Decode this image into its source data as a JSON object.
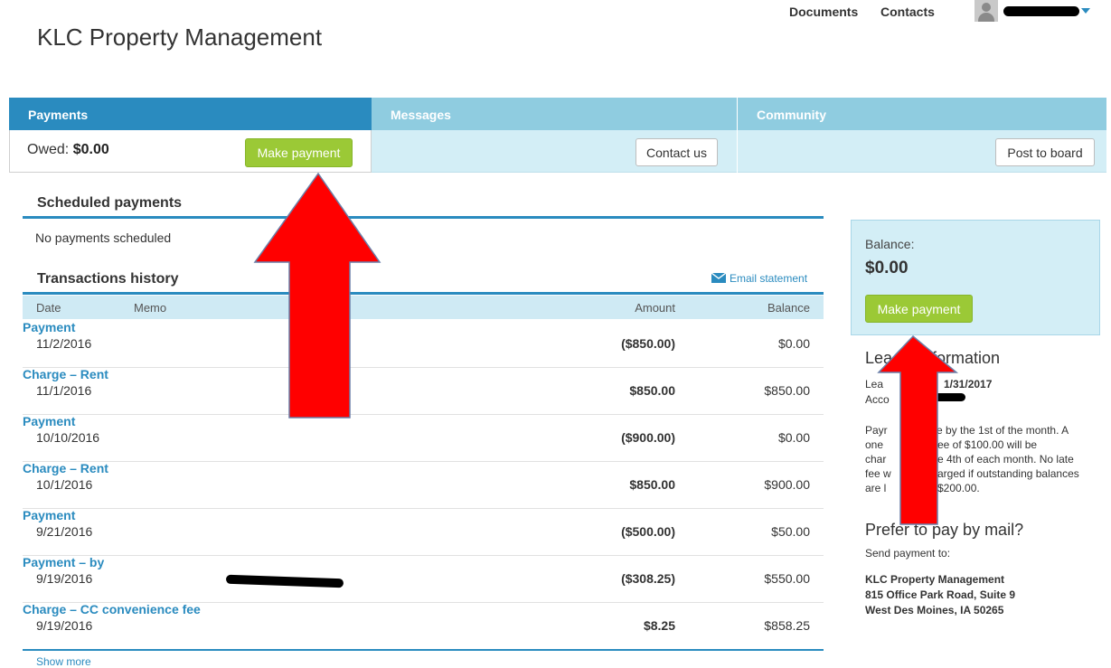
{
  "header": {
    "brand": "KLC Property Management",
    "nav": [
      "Documents",
      "Contacts"
    ]
  },
  "tabs": [
    {
      "label": "Payments",
      "owed_label": "Owed:",
      "owed_value": "$0.00",
      "button": "Make payment"
    },
    {
      "label": "Messages",
      "button": "Contact us"
    },
    {
      "label": "Community",
      "button": "Post to board"
    }
  ],
  "scheduled": {
    "title": "Scheduled payments",
    "empty_text": "No payments scheduled"
  },
  "history": {
    "title": "Transactions history",
    "email_link": "Email statement",
    "columns": [
      "Date",
      "Memo",
      "Amount",
      "Balance"
    ],
    "rows": [
      {
        "date": "11/2/2016",
        "memo": "Payment",
        "amount": "($850.00)",
        "balance": "$0.00"
      },
      {
        "date": "11/1/2016",
        "memo": "Charge – Rent",
        "amount": "$850.00",
        "balance": "$850.00"
      },
      {
        "date": "10/10/2016",
        "memo": "Payment",
        "amount": "($900.00)",
        "balance": "$0.00"
      },
      {
        "date": "10/1/2016",
        "memo": "Charge – Rent",
        "amount": "$850.00",
        "balance": "$900.00"
      },
      {
        "date": "9/21/2016",
        "memo": "Payment",
        "amount": "($500.00)",
        "balance": "$50.00"
      },
      {
        "date": "9/19/2016",
        "memo": "Payment – by",
        "amount": "($308.25)",
        "balance": "$550.00"
      },
      {
        "date": "9/19/2016",
        "memo": "Charge – CC convenience fee",
        "amount": "$8.25",
        "balance": "$858.25"
      }
    ],
    "show_more": "Show more"
  },
  "balance": {
    "label": "Balance:",
    "value": "$0.00",
    "button": "Make payment"
  },
  "lease": {
    "title_left": "Lea",
    "title_right": "formation",
    "line1_left": "Lea",
    "line1_right": "1/31/2017",
    "line2_left": "Acco",
    "policy": [
      {
        "left": "Payr",
        "right": "e by the 1st of the month. A"
      },
      {
        "left": "one",
        "right": "ee of $100.00 will be"
      },
      {
        "left": "char",
        "right": "e 4th of each month. No late"
      },
      {
        "left": "fee w",
        "right": "arged if outstanding balances"
      },
      {
        "left": "are l",
        "right": "$200.00."
      }
    ]
  },
  "mail": {
    "title": "Prefer to pay by mail?",
    "send_to": "Send payment to:",
    "address": [
      "KLC Property Management",
      "815 Office Park Road, Suite 9",
      "West Des Moines, IA 50265"
    ]
  },
  "colors": {
    "accent_blue": "#2a8bbf",
    "tab_light": "#8fcce0",
    "panel_light": "#d3eef6",
    "button_green": "#9bc936",
    "annotation_red": "#ff0000"
  }
}
